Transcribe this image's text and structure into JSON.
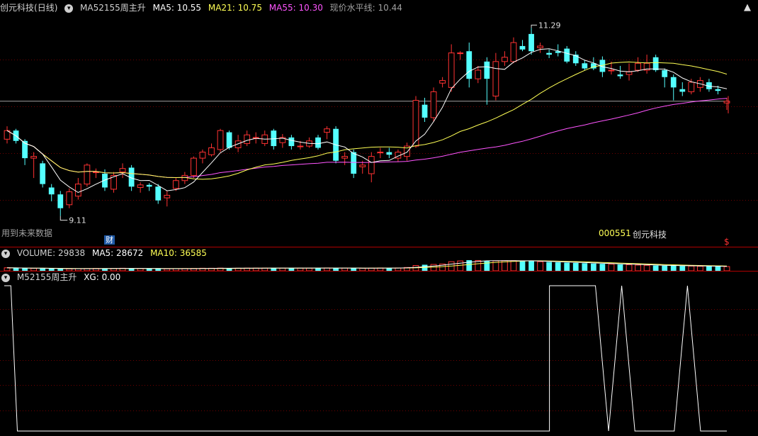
{
  "header": {
    "stock_name": "创元科技",
    "period": "(日线)",
    "indicator": "MA52155周主升",
    "ma5_label": "MA5:",
    "ma5_value": "10.55",
    "ma21_label": "MA21:",
    "ma21_value": "10.75",
    "ma55_label": "MA55:",
    "ma55_value": "10.30",
    "level_label": "现价水平线:",
    "level_value": "10.44"
  },
  "annotations": {
    "high_label": "11.29",
    "low_label": "9.11",
    "future_data": "用到未来数据",
    "cai_badge": "财",
    "code": "000551",
    "name": "创元科技",
    "dollar": "$"
  },
  "volume_header": {
    "title": "VOLUME:",
    "value": "29838",
    "ma5_label": "MA5:",
    "ma5_value": "28672",
    "ma10_label": "MA10:",
    "ma10_value": "36585"
  },
  "xg_header": {
    "title": "M52155周主升",
    "xg_label": "XG:",
    "xg_value": "0.00"
  },
  "controls": {
    "up": "▲",
    "down": "▼"
  },
  "colors": {
    "up": "#ff3232",
    "down": "#54ffff",
    "ma5": "#ffffff",
    "ma21": "#ffff55",
    "ma55": "#ff55ff",
    "level": "#a0a0a0"
  },
  "chart_data": {
    "type": "candlestick",
    "price_range": [
      9.0,
      11.4
    ],
    "level": 10.44,
    "candles": [
      [
        10.0,
        10.1,
        10.15,
        9.95
      ],
      [
        10.1,
        9.98,
        10.12,
        9.95
      ],
      [
        9.98,
        9.78,
        10.0,
        9.7
      ],
      [
        9.78,
        9.8,
        9.85,
        9.55
      ],
      [
        9.72,
        9.48,
        9.75,
        9.44
      ],
      [
        9.44,
        9.36,
        9.48,
        9.28
      ],
      [
        9.36,
        9.2,
        9.4,
        9.11
      ],
      [
        9.24,
        9.39,
        9.43,
        9.2
      ],
      [
        9.34,
        9.48,
        9.55,
        9.3
      ],
      [
        9.48,
        9.7,
        9.72,
        9.45
      ],
      [
        9.62,
        9.62,
        9.66,
        9.55
      ],
      [
        9.6,
        9.44,
        9.65,
        9.4
      ],
      [
        9.42,
        9.58,
        9.62,
        9.38
      ],
      [
        9.62,
        9.66,
        9.72,
        9.55
      ],
      [
        9.67,
        9.45,
        9.7,
        9.4
      ],
      [
        9.44,
        9.47,
        9.5,
        9.38
      ],
      [
        9.47,
        9.45,
        9.49,
        9.4
      ],
      [
        9.45,
        9.29,
        9.48,
        9.25
      ],
      [
        9.32,
        9.35,
        9.4,
        9.22
      ],
      [
        9.43,
        9.52,
        9.55,
        9.4
      ],
      [
        9.52,
        9.58,
        9.62,
        9.48
      ],
      [
        9.58,
        9.78,
        9.8,
        9.55
      ],
      [
        9.78,
        9.85,
        9.88,
        9.72
      ],
      [
        9.82,
        9.9,
        9.95,
        9.8
      ],
      [
        9.88,
        10.1,
        10.12,
        9.85
      ],
      [
        10.08,
        9.9,
        10.1,
        9.88
      ],
      [
        9.9,
        9.98,
        10.05,
        9.85
      ],
      [
        9.95,
        10.05,
        10.1,
        9.92
      ],
      [
        10.02,
        10.02,
        10.08,
        9.95
      ],
      [
        9.95,
        10.05,
        10.1,
        9.92
      ],
      [
        10.1,
        9.92,
        10.12,
        9.88
      ],
      [
        9.96,
        10.02,
        10.06,
        9.9
      ],
      [
        10.02,
        9.92,
        10.05,
        9.88
      ],
      [
        9.92,
        9.92,
        9.98,
        9.88
      ],
      [
        9.92,
        9.98,
        10.02,
        9.9
      ],
      [
        10.02,
        9.9,
        10.05,
        9.88
      ],
      [
        10.08,
        10.12,
        10.15,
        10.0
      ],
      [
        10.12,
        9.75,
        10.15,
        9.72
      ],
      [
        9.78,
        9.8,
        9.85,
        9.7
      ],
      [
        9.85,
        9.6,
        9.88,
        9.55
      ],
      [
        9.68,
        9.7,
        9.75,
        9.6
      ],
      [
        9.6,
        9.8,
        9.85,
        9.5
      ],
      [
        9.85,
        9.85,
        9.9,
        9.78
      ],
      [
        9.85,
        9.82,
        9.9,
        9.78
      ],
      [
        9.78,
        9.85,
        9.88,
        9.74
      ],
      [
        9.8,
        9.92,
        9.96,
        9.75
      ],
      [
        9.92,
        10.45,
        10.5,
        9.9
      ],
      [
        10.4,
        10.25,
        10.48,
        10.2
      ],
      [
        10.25,
        10.55,
        10.6,
        10.2
      ],
      [
        10.65,
        10.68,
        10.72,
        10.6
      ],
      [
        10.6,
        11.0,
        11.1,
        10.55
      ],
      [
        11.0,
        11.0,
        11.02,
        10.92
      ],
      [
        11.02,
        10.7,
        11.12,
        10.6
      ],
      [
        10.7,
        10.8,
        10.85,
        10.65
      ],
      [
        10.9,
        10.7,
        10.95,
        10.4
      ],
      [
        10.5,
        10.9,
        11.0,
        10.45
      ],
      [
        10.9,
        10.95,
        11.02,
        10.85
      ],
      [
        10.9,
        11.12,
        11.18,
        10.88
      ],
      [
        11.08,
        11.04,
        11.15,
        11.02
      ],
      [
        11.22,
        11.02,
        11.29,
        10.98
      ],
      [
        11.06,
        11.08,
        11.12,
        11.0
      ],
      [
        11.0,
        10.98,
        11.04,
        10.94
      ],
      [
        11.02,
        11.0,
        11.1,
        10.96
      ],
      [
        11.05,
        10.9,
        11.08,
        10.88
      ],
      [
        10.98,
        10.88,
        11.02,
        10.85
      ],
      [
        10.88,
        10.82,
        10.92,
        10.8
      ],
      [
        10.88,
        10.82,
        10.95,
        10.8
      ],
      [
        10.92,
        10.78,
        10.96,
        10.72
      ],
      [
        10.8,
        10.8,
        10.9,
        10.75
      ],
      [
        10.75,
        10.73,
        10.85,
        10.7
      ],
      [
        10.75,
        10.78,
        10.88,
        10.68
      ],
      [
        10.8,
        10.88,
        10.95,
        10.78
      ],
      [
        10.8,
        10.88,
        10.98,
        10.76
      ],
      [
        10.95,
        10.8,
        10.98,
        10.78
      ],
      [
        10.8,
        10.72,
        10.82,
        10.6
      ],
      [
        10.72,
        10.6,
        10.75,
        10.45
      ],
      [
        10.58,
        10.55,
        10.66,
        10.5
      ],
      [
        10.55,
        10.66,
        10.7,
        10.52
      ],
      [
        10.6,
        10.68,
        10.72,
        10.55
      ],
      [
        10.66,
        10.58,
        10.7,
        10.55
      ],
      [
        10.58,
        10.56,
        10.62,
        10.52
      ],
      [
        10.42,
        10.44,
        10.48,
        10.34
      ]
    ],
    "volumes": [
      20,
      18,
      17,
      16,
      15,
      14,
      13,
      13,
      14,
      15,
      16,
      15,
      16,
      17,
      16,
      15,
      14,
      13,
      13,
      14,
      15,
      16,
      17,
      17,
      18,
      17,
      17,
      18,
      18,
      18,
      19,
      18,
      18,
      18,
      18,
      18,
      19,
      18,
      18,
      17,
      17,
      18,
      19,
      19,
      19,
      22,
      35,
      40,
      42,
      45,
      60,
      65,
      70,
      68,
      65,
      66,
      67,
      67,
      65,
      63,
      60,
      58,
      56,
      54,
      52,
      50,
      48,
      46,
      44,
      42,
      40,
      38,
      36,
      35,
      34,
      33,
      32,
      31,
      30,
      30,
      29,
      28
    ],
    "xg": [
      [
        0,
        1
      ],
      [
        1,
        1
      ],
      [
        2,
        0
      ],
      [
        10,
        0
      ],
      [
        80,
        0
      ],
      [
        83,
        0
      ],
      [
        83,
        1
      ],
      [
        87,
        1
      ],
      [
        90,
        1
      ],
      [
        92,
        0
      ],
      [
        94,
        1
      ],
      [
        96,
        0
      ],
      [
        102,
        0
      ],
      [
        104,
        1
      ],
      [
        106,
        0
      ],
      [
        110,
        0
      ]
    ]
  }
}
